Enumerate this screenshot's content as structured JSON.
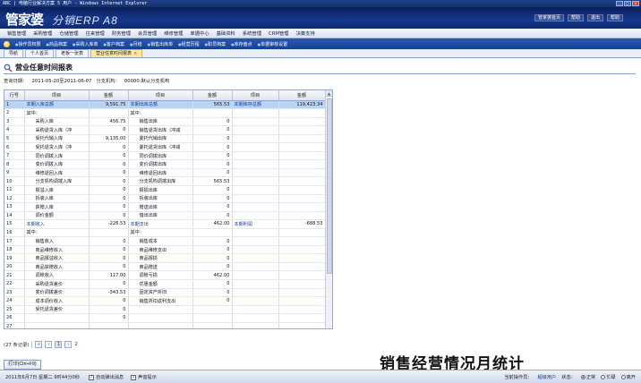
{
  "window": {
    "title": "ABC | 电脑行业解决方案 5 用户 - Windows Internet Explorer"
  },
  "header": {
    "logo_cn": "管家婆",
    "logo_en": "分销ERP A8",
    "links": [
      "管家婆首页",
      "帮助",
      "注销",
      "退出",
      "帮助"
    ]
  },
  "menu": [
    "销售管理",
    "采购管理",
    "仓储管理",
    "往来管理",
    "财务管理",
    "会员管理",
    "维修管理",
    "单据中心",
    "基础资料",
    "系统管理",
    "CRM管理",
    "决策支持"
  ],
  "quickbar": [
    "操作员权限",
    "商品档案",
    "采购入库单",
    "客户档案",
    "月结",
    "销售出库单",
    "经营历程",
    "职员档案",
    "库存盘点",
    "单据审核设置"
  ],
  "tabs": [
    {
      "label": "导航",
      "active": false
    },
    {
      "label": "个人首页",
      "active": false
    },
    {
      "label": "老板一张表",
      "active": false
    },
    {
      "label": "营业任意时间报表",
      "active": true
    }
  ],
  "report": {
    "title": "营业任意时间报表",
    "query_label": "查询日期：",
    "query_value": "2011-05-20至2011-06-07",
    "branch_label": "分支机构：",
    "branch_value": "00000:默认分支机构"
  },
  "table": {
    "columns": [
      "行号",
      "项目",
      "金额",
      "项目",
      "金额",
      "项目",
      "金额"
    ],
    "rows": [
      [
        "1",
        "本期入库总额",
        "9,591.75",
        "本期出库总额",
        "565.53",
        "本期库存总额",
        "119,423.34"
      ],
      [
        "2",
        "其中：",
        "",
        "其中：",
        "",
        "",
        ""
      ],
      [
        "3",
        "采购入库",
        "456.75",
        "销售出库",
        "0",
        "",
        ""
      ],
      [
        "4",
        "采购退货入库（冲",
        "0",
        "销售退货出库（冲减",
        "0",
        "",
        ""
      ],
      [
        "5",
        "受托代销入库",
        "9,135.00",
        "委托代销出库",
        "0",
        "",
        ""
      ],
      [
        "6",
        "受托退货入库（冲",
        "0",
        "委托退货出库（冲减",
        "0",
        "",
        ""
      ],
      [
        "7",
        "同价调拨入库",
        "0",
        "同价调拨出库",
        "0",
        "",
        ""
      ],
      [
        "8",
        "变价调拨入库",
        "0",
        "变价调拨出库",
        "0",
        "",
        ""
      ],
      [
        "9",
        "维修退回入库",
        "0",
        "维修退回出库",
        "0",
        "",
        ""
      ],
      [
        "10",
        "分支机构调拨入库",
        "0",
        "分支机构调拨出库",
        "565.53",
        "",
        ""
      ],
      [
        "11",
        "报溢入库",
        "0",
        "报损出库",
        "0",
        "",
        ""
      ],
      [
        "12",
        "拆装入库",
        "0",
        "拆装出库",
        "0",
        "",
        ""
      ],
      [
        "13",
        "获赠入库",
        "0",
        "赠送出库",
        "0",
        "",
        ""
      ],
      [
        "14",
        "调价金额",
        "0",
        "借出出库",
        "0",
        "",
        ""
      ],
      [
        "15",
        "本期收入",
        "-226.53",
        "本期支出",
        "462.00",
        "本期利润",
        "-688.53"
      ],
      [
        "16",
        "其中：",
        "",
        "其中：",
        "",
        "",
        ""
      ],
      [
        "17",
        "销售收入",
        "0",
        "销售成本",
        "0",
        "",
        ""
      ],
      [
        "18",
        "商品维修收入",
        "0",
        "商品维修支出",
        "0",
        "",
        ""
      ],
      [
        "19",
        "商品报溢收入",
        "0",
        "商品报损",
        "0",
        "",
        ""
      ],
      [
        "20",
        "商品获赠收入",
        "0",
        "商品赠送",
        "0",
        "",
        ""
      ],
      [
        "21",
        "调账收入",
        "117.00",
        "调账亏损",
        "462.00",
        "",
        ""
      ],
      [
        "22",
        "采购退货差价",
        "0",
        "优惠金额",
        "0",
        "",
        ""
      ],
      [
        "23",
        "变价调拨差价",
        "-343.53",
        "固定资产折旧",
        "0",
        "",
        ""
      ],
      [
        "24",
        "成本调价收入",
        "0",
        "销售折扣返利支出",
        "0",
        "",
        ""
      ],
      [
        "25",
        "受托退货差价",
        "0",
        "",
        "",
        "",
        ""
      ],
      [
        "26",
        "",
        "0",
        "",
        "",
        "",
        ""
      ],
      [
        "27",
        "",
        "",
        "",
        "",
        "",
        ""
      ]
    ]
  },
  "pager": {
    "records": "(27 条记录)",
    "first": "«",
    "prev": "‹",
    "page1": "1",
    "next": "›",
    "page2": "2"
  },
  "buttons": {
    "print": "打印(Ctrl+F9)"
  },
  "caption": "销售经营情况月统计",
  "status": {
    "datetime": "2011年6月7日 星期二 9时44分0秒",
    "auto_popup": "自动弹出消息",
    "sound": "声音提示",
    "operator_label": "当前操作员：",
    "operator": "超级用户",
    "state_label": "状态：",
    "state_options": [
      "正常",
      "忙碌",
      "离开"
    ]
  }
}
